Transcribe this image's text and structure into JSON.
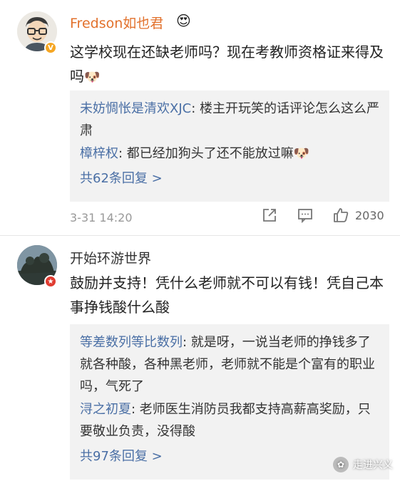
{
  "comments": [
    {
      "username": "Fredson如也君",
      "text": "这学校现在还缺老师吗？现在考教师资格证来得及吗",
      "replies": [
        {
          "user": "未妨惆怅是清欢XJC",
          "text": ": 楼主开玩笑的话评论怎么这么严肃"
        },
        {
          "user": "樟梓权",
          "text": ": 都已经加狗头了还不能放过嘛"
        }
      ],
      "more_replies": "共62条回复 >",
      "timestamp": "3-31 14:20",
      "likes": "2030"
    },
    {
      "username": "开始环游世界",
      "text": "鼓励并支持！凭什么老师就不可以有钱！凭自己本事挣钱酸什么酸",
      "replies": [
        {
          "user": "等差数列等比数列",
          "text": ": 就是呀，一说当老师的挣钱多了就各种酸，各种黑老师，老师就不能是个富有的职业吗，气死了"
        },
        {
          "user": "浔之初夏",
          "text": ": 老师医生消防员我都支持高薪高奖励，只要敬业负责，没得酸"
        }
      ],
      "more_replies": "共97条回复 >"
    }
  ],
  "watermark": "走进兴义",
  "colors": {
    "username_highlight": "#e2712c",
    "link": "#4a6fa5",
    "reply_bg": "#f2f2f2"
  },
  "icons": [
    "vip-crown-icon",
    "doge-emoji-icon",
    "share-icon",
    "reply-icon",
    "like-icon"
  ]
}
